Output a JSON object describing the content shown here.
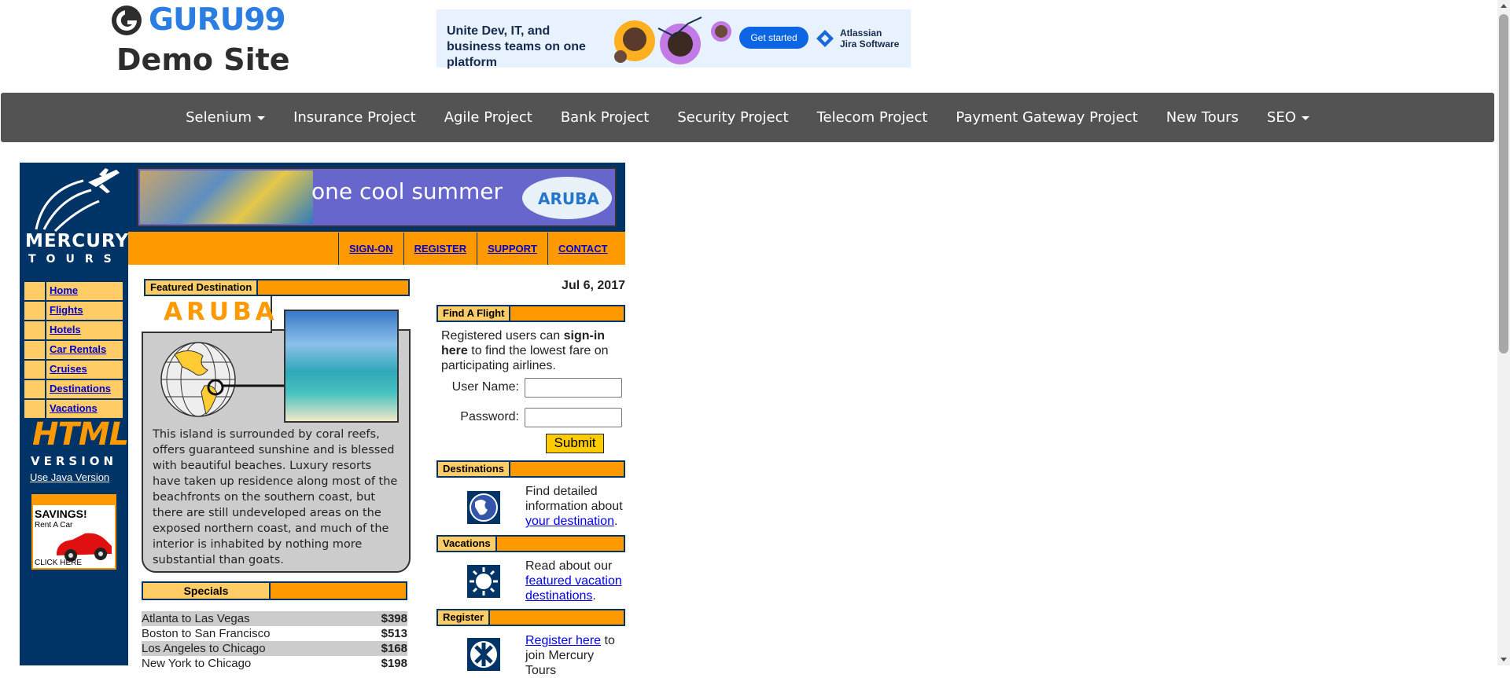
{
  "header": {
    "brand": "GURU99",
    "subtitle": "Demo Site"
  },
  "ad": {
    "headline": "Unite Dev, IT, and business teams on one platform",
    "button": "Get started",
    "brand": "Atlassian\nJira Software"
  },
  "nav": {
    "items": [
      {
        "label": "Selenium",
        "dropdown": true
      },
      {
        "label": "Insurance Project"
      },
      {
        "label": "Agile Project"
      },
      {
        "label": "Bank Project"
      },
      {
        "label": "Security Project"
      },
      {
        "label": "Telecom Project"
      },
      {
        "label": "Payment Gateway Project"
      },
      {
        "label": "New Tours"
      },
      {
        "label": "SEO",
        "dropdown": true
      }
    ]
  },
  "mercury": {
    "logo_line1": "MERCURY",
    "logo_line2": "TOURS",
    "sidenav": [
      "Home",
      "Flights",
      "Hotels",
      "Car Rentals",
      "Cruises",
      "Destinations",
      "Vacations"
    ],
    "html_version_big": "HTML",
    "html_version_small": "VERSION",
    "java_link": "Use Java Version",
    "savings_title": "SAVINGS!",
    "savings_sub": "Rent A Car",
    "savings_cta": "CLICK HERE",
    "banner_text": "one cool summer",
    "banner_logo": "ARUBA",
    "toplinks": [
      "SIGN-ON",
      "REGISTER",
      "SUPPORT",
      "CONTACT"
    ]
  },
  "featured": {
    "header": "Featured Destination",
    "name": "ARUBA",
    "description": "This island is surrounded by coral reefs, offers guaranteed sunshine and is blessed with beautiful beaches. Luxury resorts have taken up residence along most of the beachfronts on the southern coast, but there are still undeveloped areas on the exposed northern coast, and much of the interior is inhabited by nothing more substantial than goats."
  },
  "specials": {
    "header": "Specials",
    "rows": [
      {
        "route": "Atlanta to Las Vegas",
        "price": "$398"
      },
      {
        "route": "Boston to San Francisco",
        "price": "$513"
      },
      {
        "route": "Los Angeles to Chicago",
        "price": "$168"
      },
      {
        "route": "New York to Chicago",
        "price": "$198"
      }
    ]
  },
  "right": {
    "date": "Jul 6, 2017",
    "find_flight_header": "Find A Flight",
    "find_flight_pre": "Registered users can ",
    "find_flight_bold": "sign-in here",
    "find_flight_post": " to find the lowest fare on participating airlines.",
    "user_label": "User Name:",
    "pass_label": "Password:",
    "user_value": "",
    "pass_value": "",
    "submit": "Submit",
    "destinations_header": "Destinations",
    "destinations_pre": "Find detailed information about ",
    "destinations_link": "your destination",
    "destinations_post": ".",
    "vacations_header": "Vacations",
    "vacations_pre": "Read about our ",
    "vacations_link": "featured vacation destinations",
    "vacations_post": ".",
    "register_header": "Register",
    "register_link": "Register here",
    "register_post": " to join Mercury Tours"
  },
  "colors": {
    "navy": "#003366",
    "orange": "#ff9900",
    "light_orange": "#ffcc66",
    "navbar": "#535353",
    "guru_blue": "#2b7de1"
  }
}
